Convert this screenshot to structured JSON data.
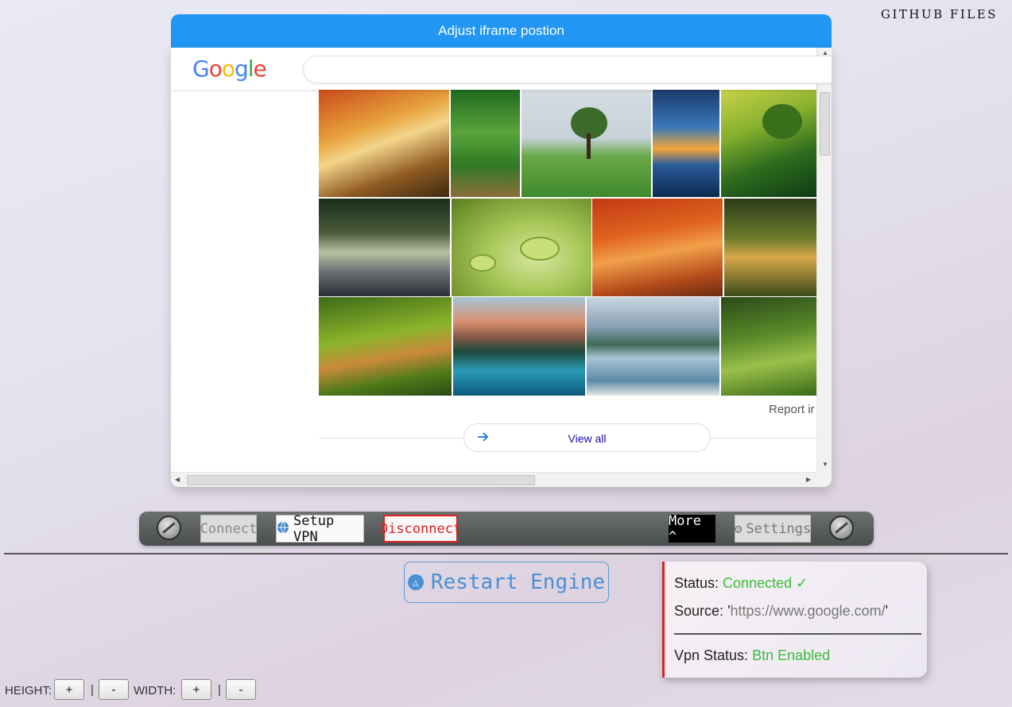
{
  "header": {
    "github_label": "GITHUB FILES",
    "adjust_label": "Adjust iframe postion"
  },
  "iframe": {
    "logo_letters": [
      "G",
      "o",
      "o",
      "g",
      "l",
      "e"
    ],
    "search_value": "",
    "report_text": "Report ir",
    "view_all_label": "View all",
    "arrow_icon": "arrow-right-icon"
  },
  "toolbar": {
    "connect_label": "Connect",
    "setup_label": "Setup VPN",
    "disconnect_label": "Disconnect",
    "more_label": "More ^",
    "settings_label": "Settings"
  },
  "restart": {
    "label": "Restart Engine"
  },
  "status": {
    "status_label": "Status:",
    "status_value": "Connected",
    "status_check": "✓",
    "source_label": "Source:",
    "source_value": "https://www.google.com/",
    "vpn_label": "Vpn Status:",
    "vpn_value": "Btn Enabled"
  },
  "sizebar": {
    "height_label": "HEIGHT:",
    "width_label": "WIDTH:",
    "plus": "+",
    "minus": "-",
    "separator": "|"
  },
  "colors": {
    "accent_blue": "#2196f3",
    "toolbar_dark": "#4a4e4e",
    "disconnect_red": "#e02020",
    "status_green": "#3cbc3c"
  }
}
